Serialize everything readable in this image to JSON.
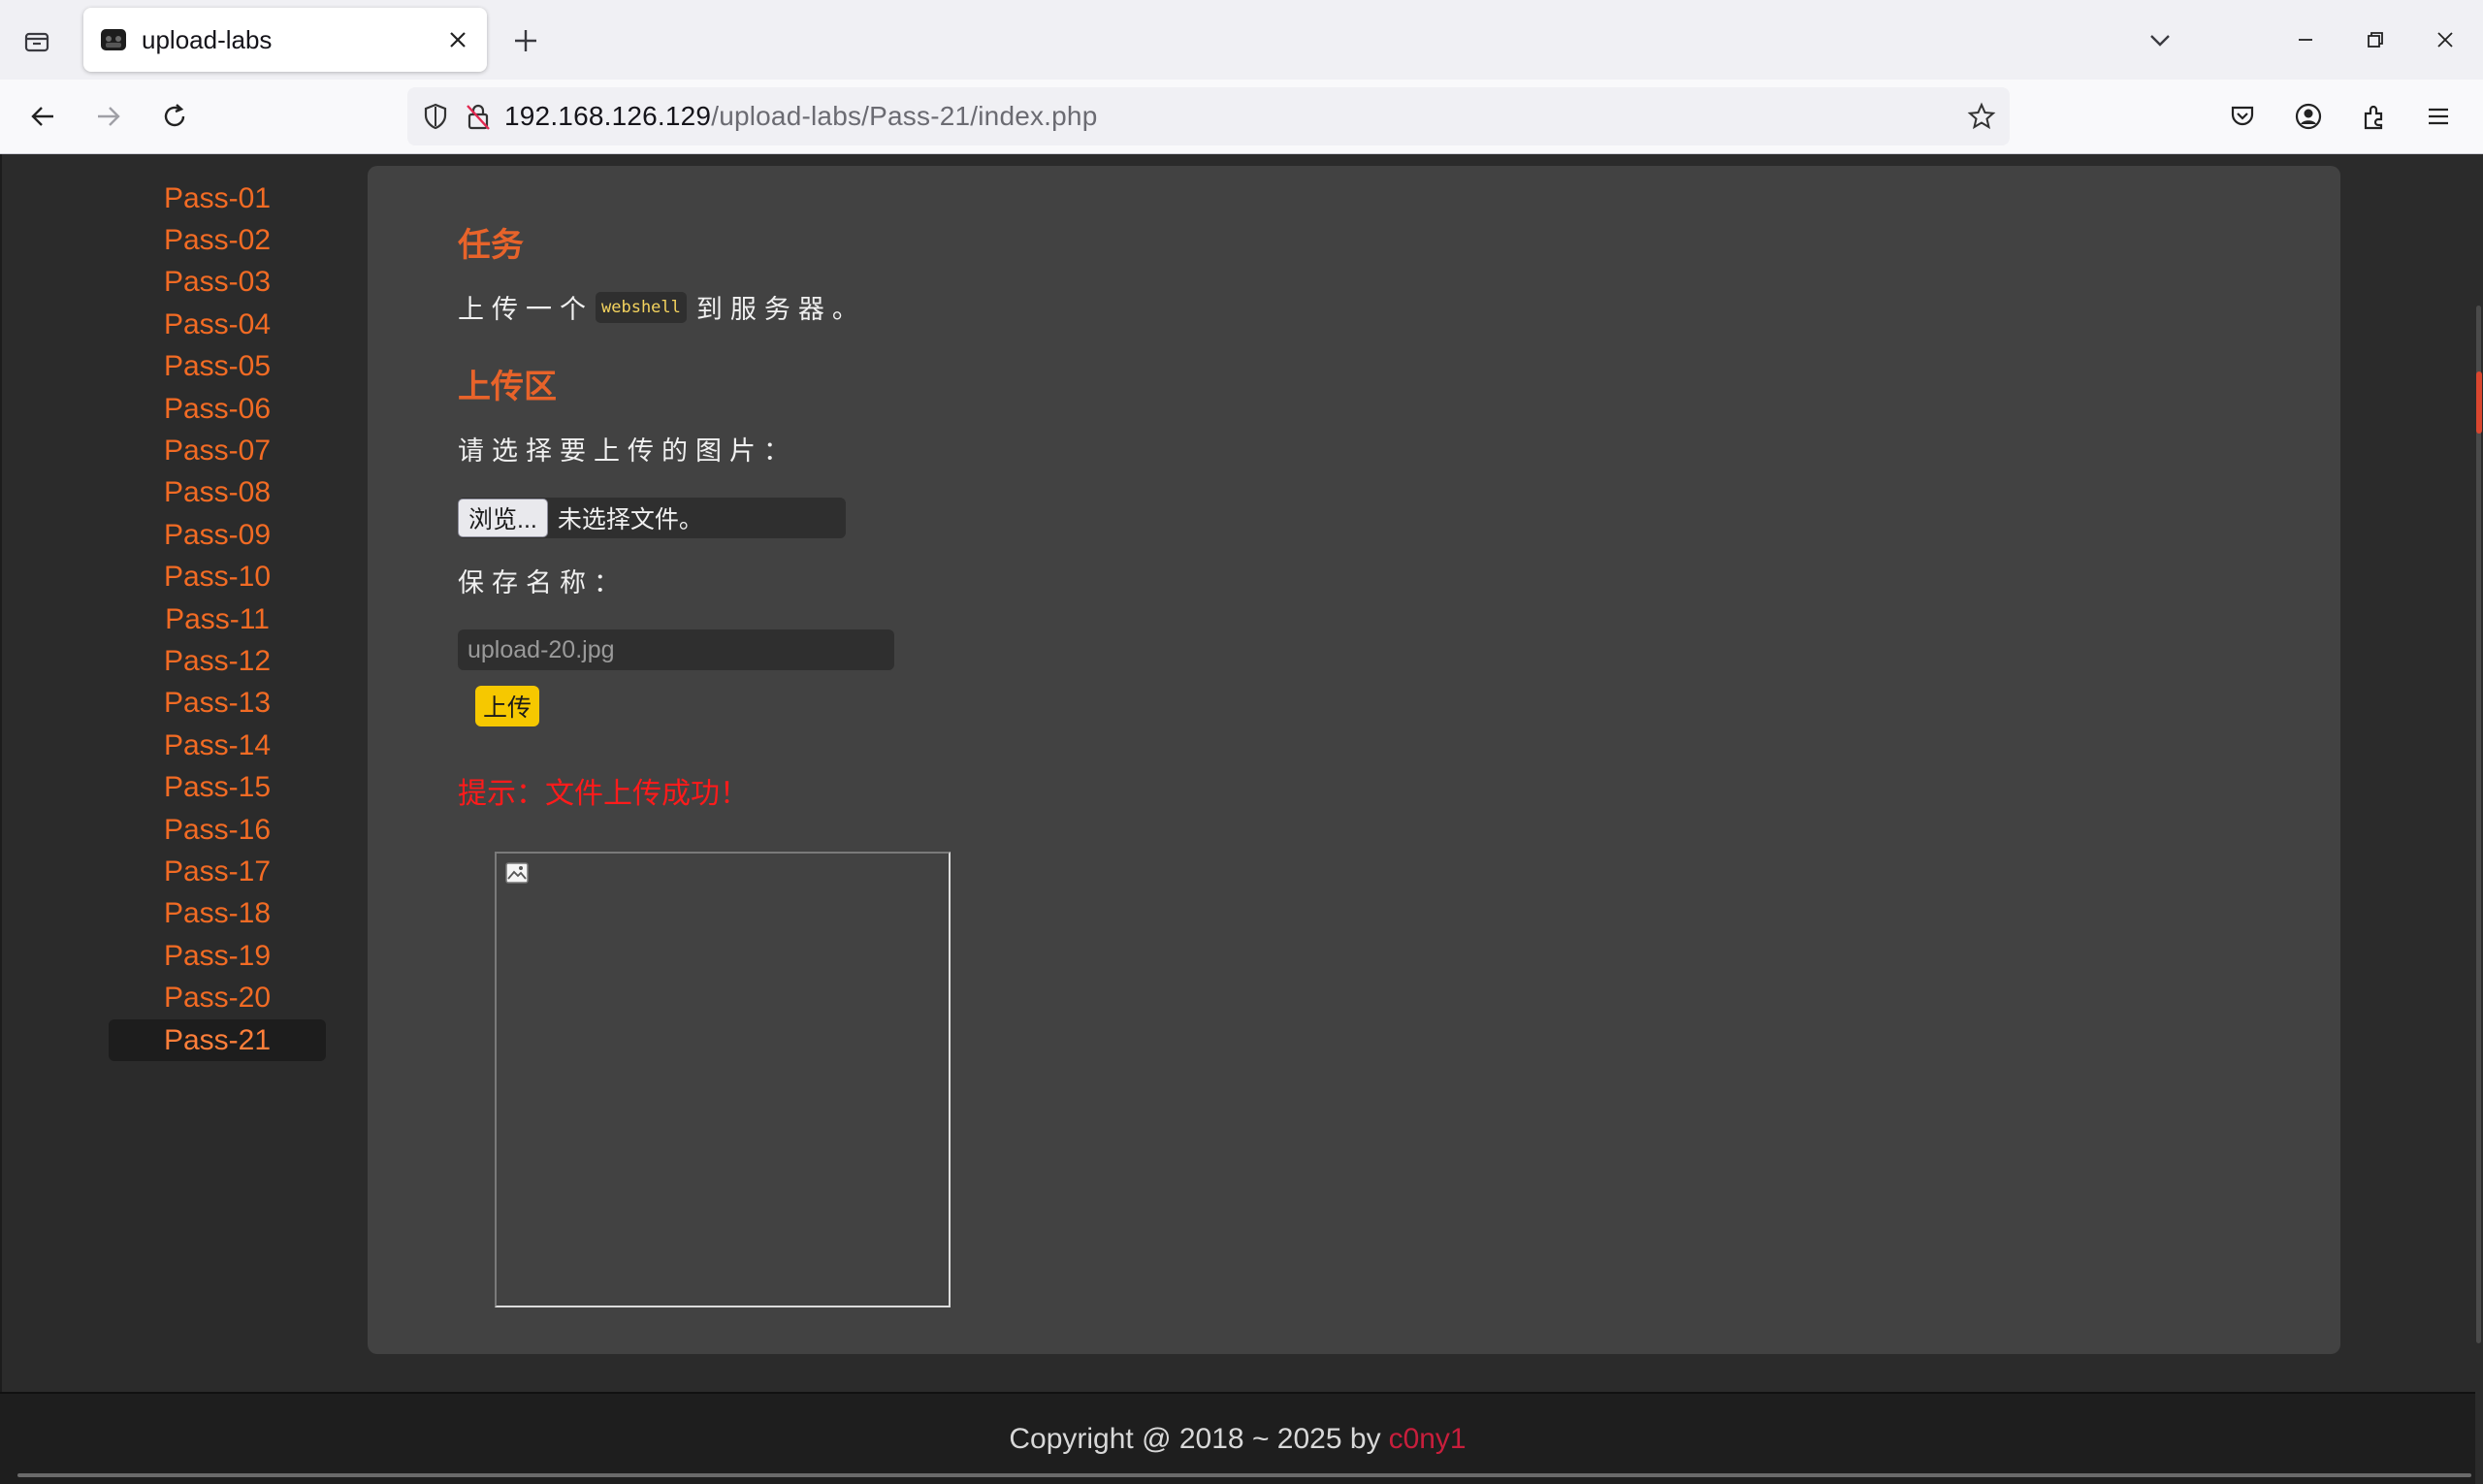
{
  "browser": {
    "tab_title": "upload-labs",
    "url_host": "192.168.126.129",
    "url_path": "/upload-labs/Pass-21/index.php"
  },
  "sidebar": {
    "items": [
      {
        "label": "Pass-01"
      },
      {
        "label": "Pass-02"
      },
      {
        "label": "Pass-03"
      },
      {
        "label": "Pass-04"
      },
      {
        "label": "Pass-05"
      },
      {
        "label": "Pass-06"
      },
      {
        "label": "Pass-07"
      },
      {
        "label": "Pass-08"
      },
      {
        "label": "Pass-09"
      },
      {
        "label": "Pass-10"
      },
      {
        "label": "Pass-11"
      },
      {
        "label": "Pass-12"
      },
      {
        "label": "Pass-13"
      },
      {
        "label": "Pass-14"
      },
      {
        "label": "Pass-15"
      },
      {
        "label": "Pass-16"
      },
      {
        "label": "Pass-17"
      },
      {
        "label": "Pass-18"
      },
      {
        "label": "Pass-19"
      },
      {
        "label": "Pass-20"
      },
      {
        "label": "Pass-21"
      }
    ],
    "active": "Pass-21"
  },
  "main": {
    "task_heading": "任务",
    "task_prefix": "上传一个",
    "task_code": "webshell",
    "task_suffix": "到服务器。",
    "upload_heading": "上传区",
    "choose_label": "请选择要上传的图片：",
    "browse_label": "浏览...",
    "file_status": "未选择文件。",
    "save_label": "保存名称：",
    "save_value": "upload-20.jpg",
    "submit_label": "上传",
    "tip": "提示：文件上传成功！"
  },
  "footer": {
    "copyright": "Copyright @ 2018 ~ 2025 by",
    "author": "c0ny1"
  },
  "colors": {
    "accent": "#e8632a",
    "link": "#f26b24",
    "tip": "#ff1b1b",
    "button": "#f6c800",
    "author": "#c81e3c"
  }
}
